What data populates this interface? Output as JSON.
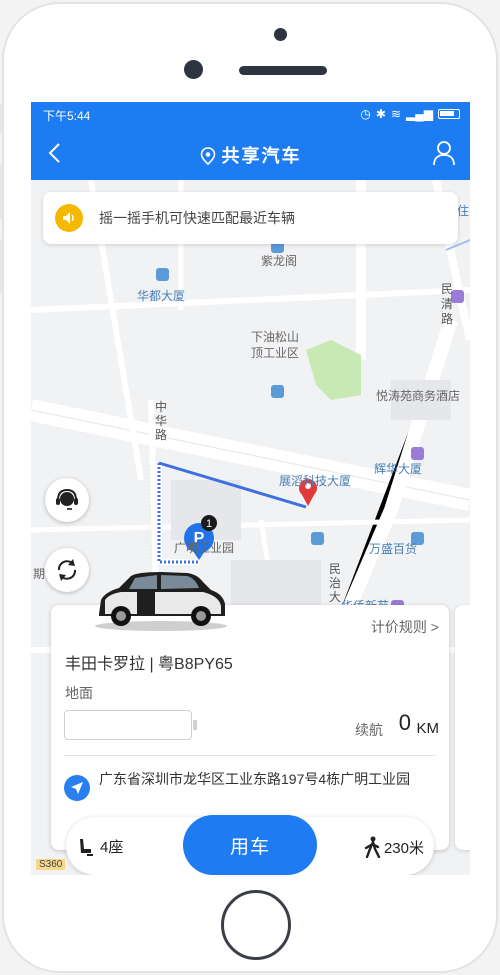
{
  "status_bar": {
    "time": "下午5:44"
  },
  "nav": {
    "title": "共享汽车"
  },
  "banner": {
    "text": "摇一摇手机可快速匹配最近车辆"
  },
  "map": {
    "labels": {
      "zilongge": "紫龙阁",
      "huadu": "华都大厦",
      "xiayou": "下油松山",
      "xiayou2": "顶工业区",
      "minqing": "民清路",
      "yuetao": "悦涛苑商务酒店",
      "zhanhao": "展滔科技大厦",
      "huihua": "辉华大厦",
      "wansheng": "万盛百货",
      "guangming": "广明工业园",
      "zhongbu": "中华路",
      "minzhi": "民治大",
      "qi": "期",
      "huaqiao": "华侨新苑",
      "s360": "S360",
      "zhu": "住"
    },
    "parking_count": "1",
    "colors": {
      "route": "#3d6fe0",
      "parking": "#2373e6",
      "park_green": "#c9e9b4"
    }
  },
  "card": {
    "pricing_rules": "计价规则 >",
    "car_name": "丰田卡罗拉 | 粤B8PY65",
    "parking_type": "地面",
    "range_label": "续航",
    "range_value": "0",
    "range_unit": "KM",
    "address": "广东省深圳市龙华区工业东路197号4栋广明工业园"
  },
  "bottom": {
    "seats": "4座",
    "use_car": "用车",
    "distance": "230米"
  },
  "icons": [
    "back-icon",
    "location-pin-icon",
    "user-icon",
    "speaker-icon",
    "customer-service-icon",
    "refresh-icon",
    "seat-icon",
    "walk-icon",
    "navigate-icon",
    "parking-icon"
  ]
}
